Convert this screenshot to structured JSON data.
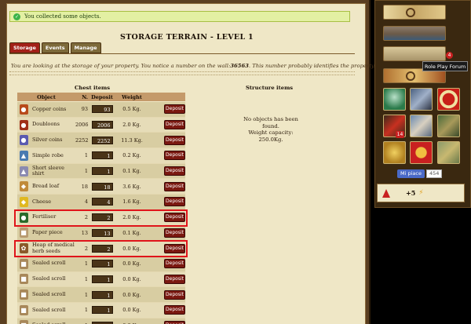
{
  "banner": {
    "text": "You collected some objects."
  },
  "page": {
    "title": "STORAGE TERRAIN - LEVEL 1"
  },
  "tabs": [
    {
      "label": "Storage",
      "active": true
    },
    {
      "label": "Events",
      "active": false
    },
    {
      "label": "Manage",
      "active": false
    }
  ],
  "intro": {
    "before": "You are looking at the storage of your property. You notice a number on the wall:",
    "number": "36563",
    "after": ". This number probably identifies the property."
  },
  "chest": {
    "heading": "Chest items",
    "columns": {
      "object": "Object",
      "n": "N.",
      "deposit": "Deposit",
      "weight": "Weight"
    },
    "deposit_button": "Deposit",
    "items": [
      {
        "name": "Copper coins",
        "n": "93",
        "deposit": "93",
        "weight": "0.5 Kg.",
        "icon": "copper-coins-icon",
        "color": "#b84a1a",
        "glyph": "●"
      },
      {
        "name": "Doubloons",
        "n": "2006",
        "deposit": "2006",
        "weight": "2.0 Kg.",
        "icon": "doubloons-icon",
        "color": "#a03018",
        "glyph": "●"
      },
      {
        "name": "Silver coins",
        "n": "2252",
        "deposit": "2252",
        "weight": "11.3 Kg.",
        "icon": "silver-coins-icon",
        "color": "#5a5ab0",
        "glyph": "●"
      },
      {
        "name": "Simple robe",
        "n": "1",
        "deposit": "1",
        "weight": "0.2 Kg.",
        "icon": "robe-icon",
        "color": "#4a7ab0",
        "glyph": "▲"
      },
      {
        "name": "Short sleeve shirt",
        "n": "1",
        "deposit": "1",
        "weight": "0.1 Kg.",
        "icon": "shirt-icon",
        "color": "#8a8ab0",
        "glyph": "▲"
      },
      {
        "name": "Bread loaf",
        "n": "18",
        "deposit": "18",
        "weight": "3.6 Kg.",
        "icon": "bread-icon",
        "color": "#c08a3a",
        "glyph": "◆"
      },
      {
        "name": "Cheese",
        "n": "4",
        "deposit": "4",
        "weight": "1.6 Kg.",
        "icon": "cheese-icon",
        "color": "#e0b820",
        "glyph": "◆"
      },
      {
        "name": "Fertiliser",
        "n": "2",
        "deposit": "2",
        "weight": "2.0 Kg.",
        "icon": "fertiliser-icon",
        "color": "#2a6a2a",
        "glyph": "●"
      },
      {
        "name": "Paper piece",
        "n": "13",
        "deposit": "13",
        "weight": "0.1 Kg.",
        "icon": "paper-icon",
        "color": "#b89a70",
        "glyph": "■"
      },
      {
        "name": "Heap of medical herb seeds",
        "n": "2",
        "deposit": "2",
        "weight": "0.0 Kg.",
        "icon": "seeds-icon",
        "color": "#8a5a2a",
        "glyph": "✿"
      },
      {
        "name": "Sealed scroll",
        "n": "1",
        "deposit": "1",
        "weight": "0.0 Kg.",
        "icon": "scroll-icon",
        "color": "#a8885a",
        "glyph": "■"
      },
      {
        "name": "Sealed scroll",
        "n": "1",
        "deposit": "1",
        "weight": "0.0 Kg.",
        "icon": "scroll-icon",
        "color": "#a8885a",
        "glyph": "■"
      },
      {
        "name": "Sealed scroll",
        "n": "1",
        "deposit": "1",
        "weight": "0.0 Kg.",
        "icon": "scroll-icon",
        "color": "#a8885a",
        "glyph": "■"
      },
      {
        "name": "Sealed scroll",
        "n": "1",
        "deposit": "1",
        "weight": "0.0 Kg.",
        "icon": "scroll-icon",
        "color": "#a8885a",
        "glyph": "■"
      },
      {
        "name": "Sealed scroll",
        "n": "1",
        "deposit": "1",
        "weight": "0.0 Kg.",
        "icon": "scroll-icon",
        "color": "#a8885a",
        "glyph": "■"
      }
    ],
    "highlighted_rows": [
      7,
      9
    ]
  },
  "structure": {
    "heading": "Structure items",
    "empty_text": "No objects has been found.",
    "capacity": "Weight capacity: 250.0Kg."
  },
  "side": {
    "tooltip": "Role Play Forum",
    "forum_badge": "4",
    "tile_badge": "14",
    "like_label": "Mi piace",
    "like_count": "454",
    "bonus": "+5"
  },
  "colors": {
    "accent": "#a22018",
    "highlight": "#e0141a",
    "banner_bg": "#e3f0a3",
    "parchment": "#efe7c6"
  }
}
